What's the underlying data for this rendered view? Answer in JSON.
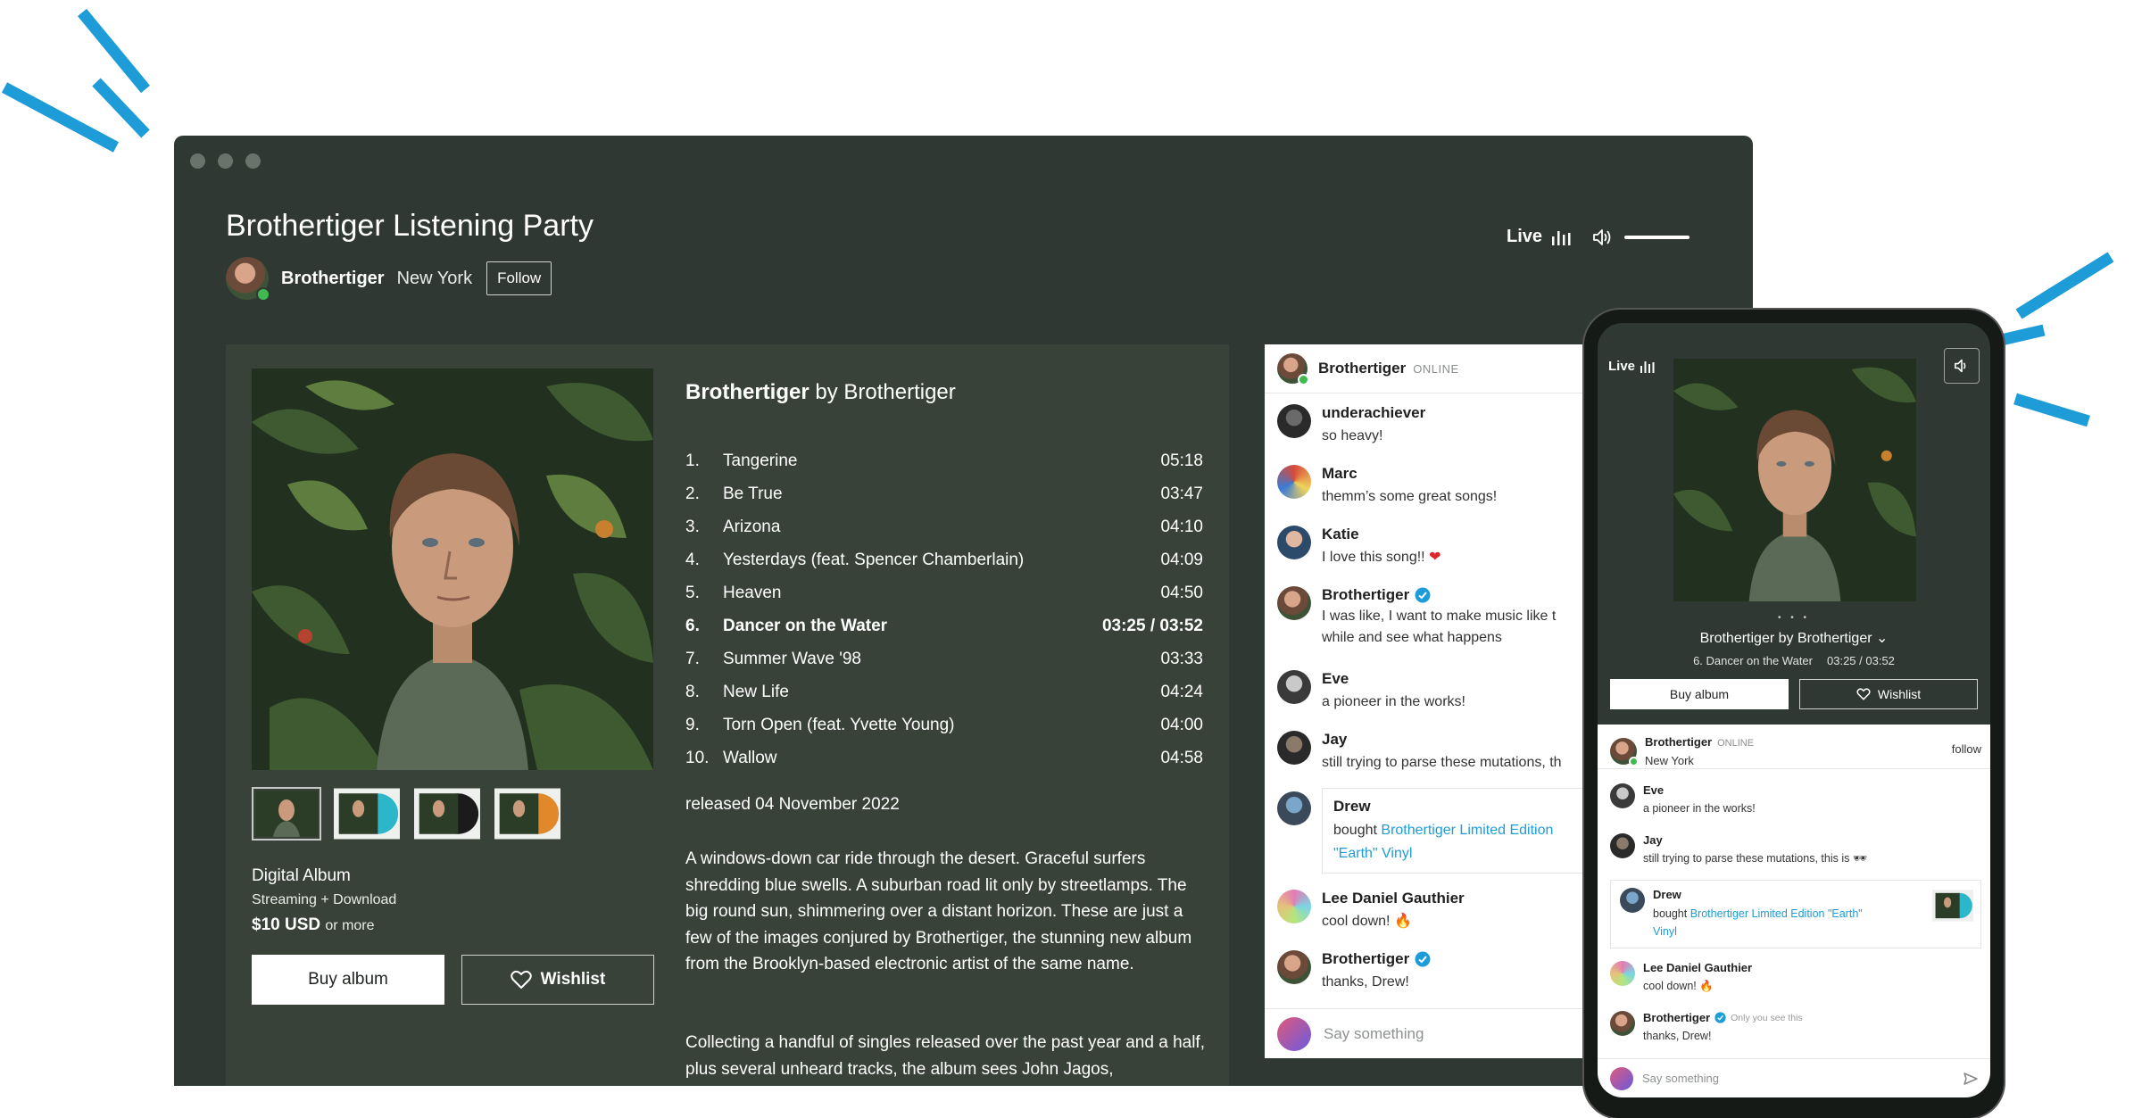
{
  "window": {
    "title": "Brothertiger Listening Party",
    "artist_name": "Brothertiger",
    "artist_location": "New York",
    "follow_label": "Follow",
    "live_label": "Live"
  },
  "album": {
    "title": "Brothertiger",
    "by": "by Brothertiger",
    "format_title": "Digital Album",
    "format_sub": "Streaming + Download",
    "price": "$10 USD",
    "price_suffix": "or more",
    "buy_label": "Buy album",
    "wishlist_label": "Wishlist",
    "released": "released 04 November 2022",
    "description": "A windows-down car ride through the desert. Graceful surfers shredding blue swells. A suburban road lit only by streetlamps. The big round sun, shimmering over a distant horizon. These are just a few of the images conjured by Brothertiger, the stunning new album from the Brooklyn-based electronic artist of the same name.",
    "description2": "Collecting a handful of singles released over the past year and a half, plus several unheard tracks, the album sees John Jagos,",
    "tracks": [
      {
        "num": "1.",
        "title": "Tangerine",
        "duration": "05:18"
      },
      {
        "num": "2.",
        "title": "Be True",
        "duration": "03:47"
      },
      {
        "num": "3.",
        "title": "Arizona",
        "duration": "04:10"
      },
      {
        "num": "4.",
        "title": "Yesterdays (feat. Spencer Chamberlain)",
        "duration": "04:09"
      },
      {
        "num": "5.",
        "title": "Heaven",
        "duration": "04:50"
      },
      {
        "num": "6.",
        "title": "Dancer on the Water",
        "duration": "03:25 / 03:52"
      },
      {
        "num": "7.",
        "title": "Summer Wave '98",
        "duration": "03:33"
      },
      {
        "num": "8.",
        "title": "New Life",
        "duration": "04:24"
      },
      {
        "num": "9.",
        "title": "Torn Open (feat. Yvette Young)",
        "duration": "04:00"
      },
      {
        "num": "10.",
        "title": "Wallow",
        "duration": "04:58"
      }
    ]
  },
  "chat": {
    "host_name": "Brothertiger",
    "host_status": "ONLINE",
    "messages": [
      {
        "who": "underachiever",
        "text": "so heavy!"
      },
      {
        "who": "Marc",
        "text": "themm’s some great songs!"
      },
      {
        "who": "Katie",
        "text": "I love this song!!"
      },
      {
        "who": "Brothertiger",
        "text": "I was like, I want to make music like t",
        "text2": "while and see what happens"
      },
      {
        "who": "Eve",
        "text": "a pioneer in the works!"
      },
      {
        "who": "Jay",
        "text": "still trying to parse these mutations, th"
      },
      {
        "who": "Lee Daniel Gauthier",
        "text": "cool down!"
      },
      {
        "who": "Brothertiger",
        "text": "thanks, Drew!"
      }
    ],
    "drew": {
      "who": "Drew",
      "bought": "bought",
      "link_line1": "Brothertiger Limited Edition",
      "link_line2": "\"Earth\" Vinyl"
    },
    "input_placeholder": "Say something"
  },
  "phone": {
    "live_label": "Live",
    "dots": "• • •",
    "album_line": "Brothertiger by Brothertiger",
    "now_track": "6.  Dancer on the Water",
    "now_time": "03:25 / 03:52",
    "buy_label": "Buy album",
    "wishlist_label": "Wishlist",
    "host_name": "Brothertiger",
    "host_status": "ONLINE",
    "host_location": "New York",
    "follow_label": "follow",
    "messages": [
      {
        "who": "Eve",
        "text": "a pioneer in the works!"
      },
      {
        "who": "Jay",
        "text": "still trying to parse these mutations, this is 🕶"
      },
      {
        "who": "Lee Daniel Gauthier",
        "text": "cool down!"
      },
      {
        "who": "Brothertiger",
        "note": "Only you see this",
        "text": "thanks, Drew!"
      }
    ],
    "drew": {
      "who": "Drew",
      "bought": "bought",
      "link_line1": "Brothertiger Limited Edition \"Earth\"",
      "link_line2": "Vinyl"
    },
    "input_placeholder": "Say something"
  },
  "colors": {
    "window_bg": "#2f3832",
    "panel_bg": "#384239",
    "accent_link": "#1e9cd7",
    "online": "#3fb950",
    "decor": "#1e9cd7"
  },
  "icons": [
    "live-bars-icon",
    "volume-icon",
    "heart-icon",
    "verified-icon",
    "send-icon",
    "chevron-down-icon",
    "fire-emoji-icon",
    "heart-emoji-icon"
  ]
}
